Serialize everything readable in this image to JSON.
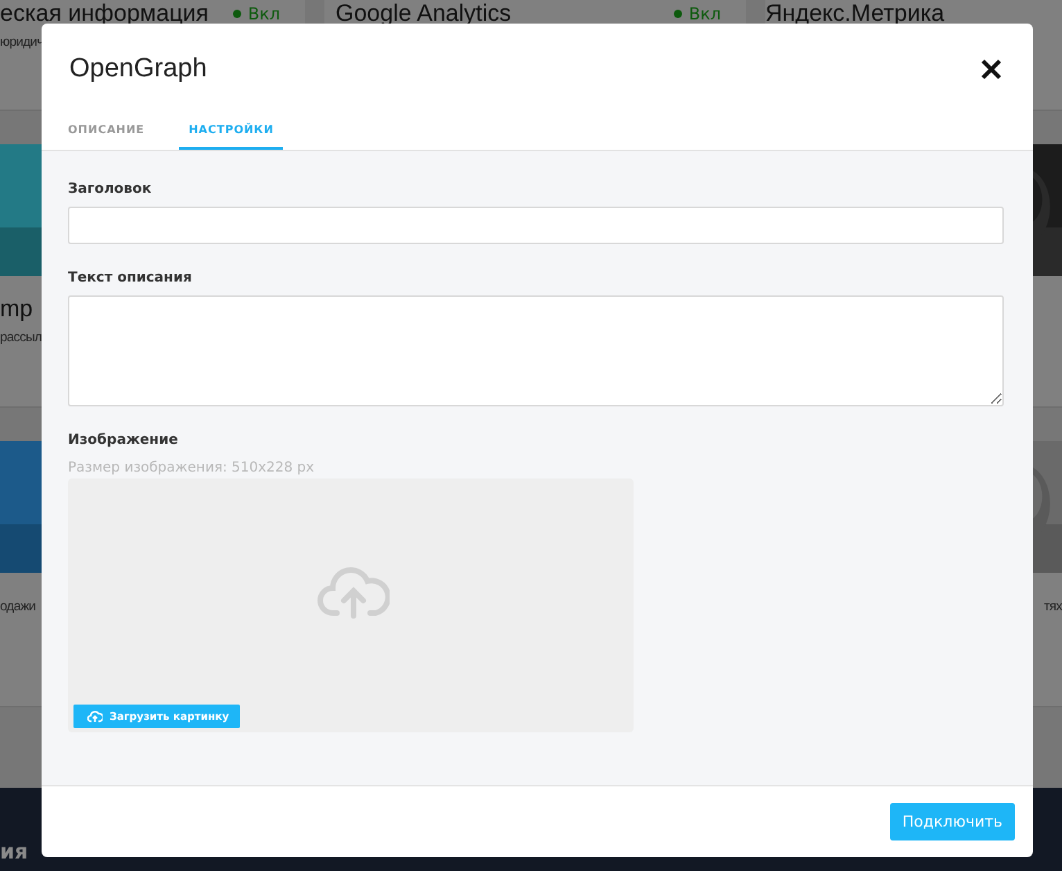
{
  "background": {
    "rows": [
      {
        "left": {
          "title": "еская информация",
          "subtitle": "юридич",
          "status": "Вкл"
        },
        "middle": {
          "title": "Google Analytics",
          "status": "Вкл"
        },
        "right": {
          "title": "Яндекс.Метрика"
        }
      },
      {
        "left": {
          "kind": "picture",
          "title": "mp",
          "subtitle": "рассыл"
        }
      },
      {
        "left": {
          "kind": "picture",
          "subtitle": "одажи"
        },
        "right": {
          "kind": "picture",
          "subtitle": "тях"
        }
      }
    ],
    "footer": "ия"
  },
  "modal": {
    "title": "OpenGraph",
    "tabs": [
      {
        "label": "ОПИСАНИЕ",
        "selected": false
      },
      {
        "label": "НАСТРОЙКИ",
        "selected": true
      }
    ],
    "fields": [
      {
        "kind": "input",
        "label": "Заголовок"
      },
      {
        "kind": "textarea",
        "label": "Текст описания"
      },
      {
        "label": "Изображение",
        "hint": "Размер изображения: 510x228 px",
        "button": "Загрузить картинку"
      }
    ],
    "submit": "Подключить"
  }
}
